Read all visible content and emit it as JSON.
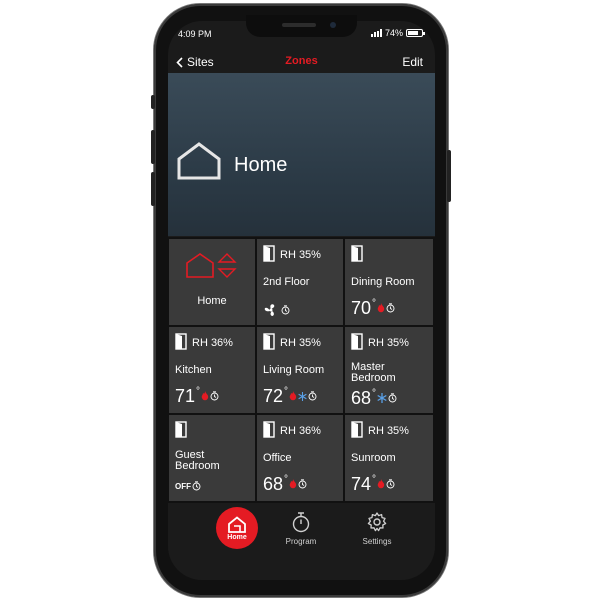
{
  "statusbar": {
    "time": "4:09 PM",
    "battery": "74%"
  },
  "navbar": {
    "back_label": "Sites",
    "title": "Zones",
    "edit_label": "Edit"
  },
  "hero": {
    "title": "Home"
  },
  "tiles": [
    {
      "name": "Home"
    },
    {
      "rh": "RH 35%",
      "name": "2nd Floor"
    },
    {
      "name": "Dining Room",
      "temp": "70"
    },
    {
      "rh": "RH 36%",
      "name": "Kitchen",
      "temp": "71"
    },
    {
      "rh": "RH 35%",
      "name": "Living Room",
      "temp": "72"
    },
    {
      "rh": "RH 35%",
      "name": "Master Bedroom",
      "temp": "68"
    },
    {
      "name": "Guest Bedroom",
      "status": "OFF"
    },
    {
      "rh": "RH 36%",
      "name": "Office",
      "temp": "68"
    },
    {
      "rh": "RH 35%",
      "name": "Sunroom",
      "temp": "74"
    }
  ],
  "degree_symbol": "°",
  "tabs": {
    "home": "Home",
    "program": "Program",
    "settings": "Settings"
  },
  "colors": {
    "accent": "#e41b23",
    "cool": "#5aa0e6",
    "tile": "#3a3a3a"
  }
}
